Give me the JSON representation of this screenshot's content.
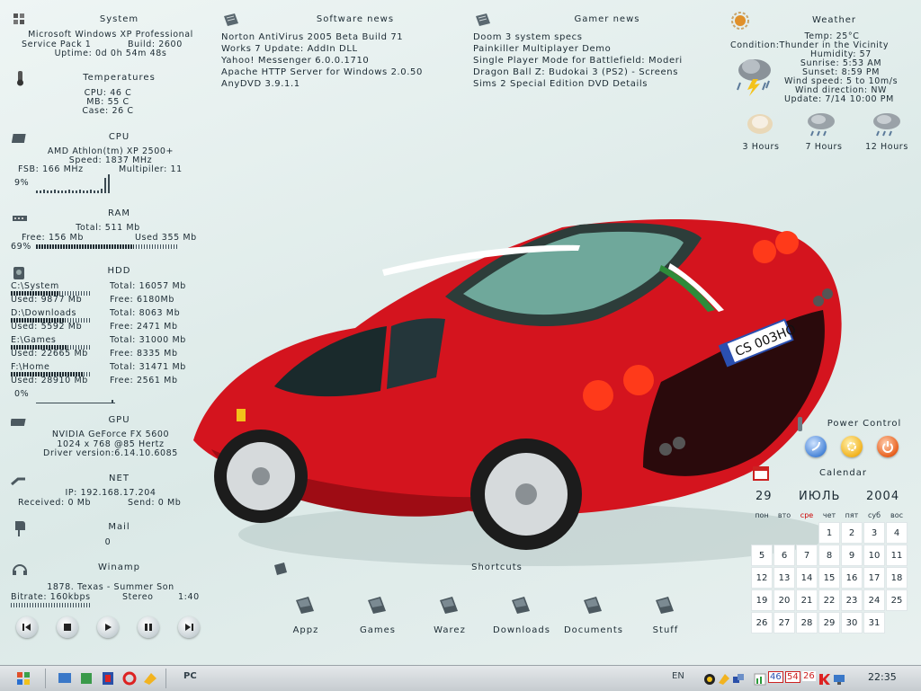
{
  "system": {
    "title": "System",
    "os": "Microsoft Windows XP Professional",
    "sp": "Service Pack 1",
    "build": "Build: 2600",
    "uptime": "Uptime: 0d 0h 54m 48s"
  },
  "temps": {
    "title": "Temperatures",
    "cpu": "CPU: 46 C",
    "mb": "MB: 55 C",
    "case": "Case: 26 C"
  },
  "cpu": {
    "title": "CPU",
    "model": "AMD Athlon(tm) XP 2500+",
    "speed": "Speed: 1837 MHz",
    "fsb": "FSB: 166 MHz",
    "mult": "Multipiler: 11",
    "load_label": "9%",
    "load": 0.09
  },
  "ram": {
    "title": "RAM",
    "total": "Total: 511 Mb",
    "free": "Free: 156 Mb",
    "used": "Used 355 Mb",
    "pct_label": "69%",
    "pct": 0.69
  },
  "hdd": {
    "title": "HDD",
    "drives": [
      {
        "name": "C:\\System",
        "total": "Total: 16057 Mb",
        "used": "Used: 9877 Mb",
        "free": "Free: 6180Mb",
        "pct": 0.62
      },
      {
        "name": "D:\\Downloads",
        "total": "Total: 8063 Mb",
        "used": "Used: 5592 Mb",
        "free": "Free: 2471 Mb",
        "pct": 0.69
      },
      {
        "name": "E:\\Games",
        "total": "Total: 31000 Mb",
        "used": "Used: 22665 Mb",
        "free": "Free: 8335 Mb",
        "pct": 0.73
      },
      {
        "name": "F:\\Home",
        "total": "Total: 31471 Mb",
        "used": "Used: 28910 Mb",
        "free": "Free: 2561 Mb",
        "pct": 0.92
      }
    ],
    "activity_label": "0%"
  },
  "gpu": {
    "title": "GPU",
    "model": "NVIDIA GeForce FX 5600",
    "mode": "1024 x 768 @85 Hertz",
    "driver": "Driver version:6.14.10.6085"
  },
  "net": {
    "title": "NET",
    "ip": "IP: 192.168.17.204",
    "received": "Received: 0 Mb",
    "send": "Send: 0 Mb"
  },
  "mail": {
    "title": "Mail",
    "count": "0"
  },
  "winamp": {
    "title": "Winamp",
    "track": "1878. Texas - Summer Son",
    "bitrate": "Bitrate: 160kbps",
    "mode": "Stereo",
    "time": "1:40",
    "controls": [
      "prev-icon",
      "stop-icon",
      "play-icon",
      "pause-icon",
      "next-icon"
    ]
  },
  "software_news": {
    "title": "Software news",
    "items": [
      "Norton AntiVirus 2005 Beta Build 71",
      "Works 7 Update: AddIn DLL",
      "Yahoo! Messenger 6.0.0.1710",
      "Apache HTTP Server for Windows 2.0.50",
      "AnyDVD 3.9.1.1"
    ]
  },
  "gamer_news": {
    "title": "Gamer news",
    "items": [
      "Doom 3 system specs",
      "Painkiller Multiplayer Demo",
      "Single Player Mode for Battlefield: Moderi",
      "Dragon Ball Z: Budokai 3 (PS2) - Screens",
      "Sims 2 Special Edition DVD Details"
    ]
  },
  "weather": {
    "title": "Weather",
    "temp": "Temp: 25°C",
    "condition": "Condition:Thunder in the Vicinity",
    "humidity": "Humidity: 57",
    "sunrise": "Sunrise: 5:53 AM",
    "sunset": "Sunset: 8:59 PM",
    "wind_speed": "Wind speed: 5 to 10m/s",
    "wind_dir": "Wind direction: NW",
    "update": "Update: 7/14 10:00 PM",
    "forecast": [
      "3 Hours",
      "7 Hours",
      "12 Hours"
    ]
  },
  "power": {
    "title": "Power Control"
  },
  "calendar": {
    "title": "Calendar",
    "day": "29",
    "month": "ИЮЛЬ",
    "year": "2004",
    "weekdays": [
      "пон",
      "вто",
      "сре",
      "чет",
      "пят",
      "суб",
      "вос"
    ],
    "today_weekday_index": 2,
    "weeks": [
      [
        "",
        "",
        "",
        "1",
        "2",
        "3",
        "4"
      ],
      [
        "5",
        "6",
        "7",
        "8",
        "9",
        "10",
        "11"
      ],
      [
        "12",
        "13",
        "14",
        "15",
        "16",
        "17",
        "18"
      ],
      [
        "19",
        "20",
        "21",
        "22",
        "23",
        "24",
        "25"
      ],
      [
        "26",
        "27",
        "28",
        "29",
        "30",
        "31",
        ""
      ]
    ]
  },
  "shortcuts": {
    "title": "Shortcuts",
    "items": [
      "Appz",
      "Games",
      "Warez",
      "Downloads",
      "Documents",
      "Stuff"
    ]
  },
  "taskbar": {
    "pc_label": "PC",
    "lang": "EN",
    "clock": "22:35",
    "tray_numbers": [
      "46",
      "54",
      "26"
    ]
  },
  "colors": {
    "car_red": "#d4141e",
    "today_red": "#cc0000",
    "background": "#e2eeec"
  }
}
